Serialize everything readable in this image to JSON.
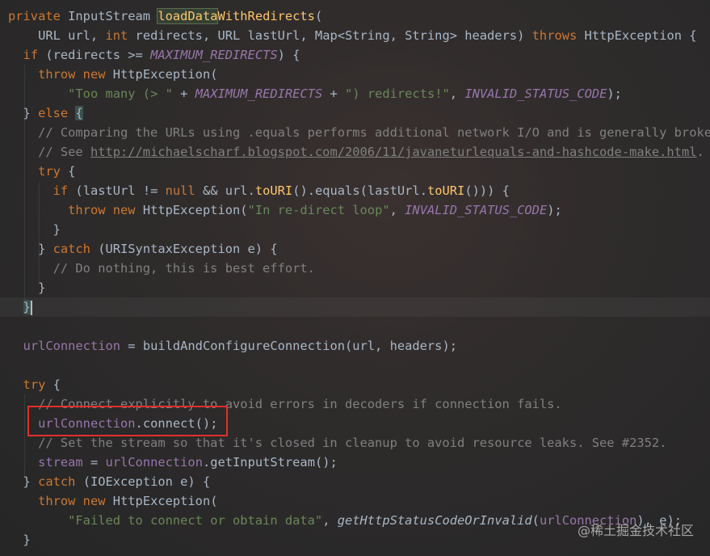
{
  "editor": {
    "lines": [
      [
        {
          "t": "private ",
          "c": "kw"
        },
        {
          "t": "InputStream ",
          "c": ""
        },
        {
          "t": "loadData",
          "c": "method hl-name"
        },
        {
          "t": "WithRedirects",
          "c": "method"
        },
        {
          "t": "(",
          "c": ""
        }
      ],
      [
        {
          "t": "    URL url, ",
          "c": ""
        },
        {
          "t": "int ",
          "c": "kw"
        },
        {
          "t": "redirects, URL lastUrl, Map<String, String> headers) ",
          "c": ""
        },
        {
          "t": "throws ",
          "c": "kw"
        },
        {
          "t": "HttpException {",
          "c": ""
        }
      ],
      [
        {
          "t": "  ",
          "c": ""
        },
        {
          "t": "if ",
          "c": "kw"
        },
        {
          "t": "(redirects >= ",
          "c": ""
        },
        {
          "t": "MAXIMUM_REDIRECTS",
          "c": "const"
        },
        {
          "t": ") {",
          "c": ""
        }
      ],
      [
        {
          "t": "    ",
          "c": ""
        },
        {
          "t": "throw new ",
          "c": "kw"
        },
        {
          "t": "HttpException(",
          "c": ""
        }
      ],
      [
        {
          "t": "        ",
          "c": ""
        },
        {
          "t": "\"Too many (> \" ",
          "c": "str"
        },
        {
          "t": "+ ",
          "c": ""
        },
        {
          "t": "MAXIMUM_REDIRECTS",
          "c": "const"
        },
        {
          "t": " + ",
          "c": ""
        },
        {
          "t": "\") redirects!\"",
          "c": "str"
        },
        {
          "t": ", ",
          "c": ""
        },
        {
          "t": "INVALID_STATUS_CODE",
          "c": "const"
        },
        {
          "t": ");",
          "c": ""
        }
      ],
      [
        {
          "t": "  } ",
          "c": ""
        },
        {
          "t": "else ",
          "c": "kw"
        },
        {
          "t": "{",
          "c": "brace-hl"
        }
      ],
      [
        {
          "t": "    // Comparing the URLs using .equals performs additional network I/O and is generally broken.",
          "c": "comment"
        }
      ],
      [
        {
          "t": "    // See ",
          "c": "comment"
        },
        {
          "t": "http://michaelscharf.blogspot.com/2006/11/javaneturlequals-and-hashcode-make.html",
          "c": "link"
        },
        {
          "t": ".",
          "c": "comment"
        }
      ],
      [
        {
          "t": "    ",
          "c": ""
        },
        {
          "t": "try ",
          "c": "kw"
        },
        {
          "t": "{",
          "c": ""
        }
      ],
      [
        {
          "t": "      ",
          "c": ""
        },
        {
          "t": "if ",
          "c": "kw"
        },
        {
          "t": "(lastUrl != ",
          "c": ""
        },
        {
          "t": "null ",
          "c": "kw"
        },
        {
          "t": "&& url.",
          "c": ""
        },
        {
          "t": "toURI",
          "c": "method"
        },
        {
          "t": "().equals(lastUrl.",
          "c": ""
        },
        {
          "t": "toURI",
          "c": "method"
        },
        {
          "t": "())) {",
          "c": ""
        }
      ],
      [
        {
          "t": "        ",
          "c": ""
        },
        {
          "t": "throw new ",
          "c": "kw"
        },
        {
          "t": "HttpException(",
          "c": ""
        },
        {
          "t": "\"In re-direct loop\"",
          "c": "str"
        },
        {
          "t": ", ",
          "c": ""
        },
        {
          "t": "INVALID_STATUS_CODE",
          "c": "const"
        },
        {
          "t": ");",
          "c": ""
        }
      ],
      [
        {
          "t": "      }",
          "c": ""
        }
      ],
      [
        {
          "t": "    } ",
          "c": ""
        },
        {
          "t": "catch ",
          "c": "kw"
        },
        {
          "t": "(URISyntaxException e) {",
          "c": ""
        }
      ],
      [
        {
          "t": "      // Do nothing, this is best effort.",
          "c": "comment"
        }
      ],
      [
        {
          "t": "    }",
          "c": ""
        }
      ],
      [
        {
          "t": "  ",
          "c": ""
        },
        {
          "t": "}",
          "c": "brace-hl"
        },
        {
          "t": "",
          "c": "caret"
        }
      ],
      [
        {
          "t": "",
          "c": ""
        }
      ],
      [
        {
          "t": "  ",
          "c": ""
        },
        {
          "t": "urlConnection",
          "c": "field"
        },
        {
          "t": " = buildAndConfigureConnection(url, headers);",
          "c": ""
        }
      ],
      [
        {
          "t": "",
          "c": ""
        }
      ],
      [
        {
          "t": "  ",
          "c": ""
        },
        {
          "t": "try ",
          "c": "kw"
        },
        {
          "t": "{",
          "c": ""
        }
      ],
      [
        {
          "t": "    // Connect explicitly to avoid errors in decoders if connection fails.",
          "c": "comment"
        }
      ],
      [
        {
          "t": "    ",
          "c": ""
        },
        {
          "t": "urlConnection",
          "c": "field"
        },
        {
          "t": ".connect();",
          "c": ""
        }
      ],
      [
        {
          "t": "    // Set the stream so that it's closed in cleanup to avoid resource leaks. See #2352.",
          "c": "comment"
        }
      ],
      [
        {
          "t": "    ",
          "c": ""
        },
        {
          "t": "stream",
          "c": "field"
        },
        {
          "t": " = ",
          "c": ""
        },
        {
          "t": "urlConnection",
          "c": "field"
        },
        {
          "t": ".getInputStream();",
          "c": ""
        }
      ],
      [
        {
          "t": "  } ",
          "c": ""
        },
        {
          "t": "catch ",
          "c": "kw"
        },
        {
          "t": "(IOException e) {",
          "c": ""
        }
      ],
      [
        {
          "t": "    ",
          "c": ""
        },
        {
          "t": "throw new ",
          "c": "kw"
        },
        {
          "t": "HttpException(",
          "c": ""
        }
      ],
      [
        {
          "t": "        ",
          "c": ""
        },
        {
          "t": "\"Failed to connect or obtain data\"",
          "c": "str"
        },
        {
          "t": ", ",
          "c": ""
        },
        {
          "t": "getHttpStatusCodeOrInvalid",
          "c": "static-call"
        },
        {
          "t": "(",
          "c": ""
        },
        {
          "t": "urlConnection",
          "c": "field"
        },
        {
          "t": "), e);",
          "c": ""
        }
      ],
      [
        {
          "t": "  }",
          "c": ""
        }
      ]
    ]
  },
  "watermark": "@稀土掘金技术社区",
  "colors": {
    "background": "#2b2b2b",
    "keyword": "#cc7832",
    "method": "#ffc66d",
    "constant": "#9876aa",
    "string": "#6a8759",
    "comment": "#808080",
    "highlight_box": "#e0302c"
  }
}
